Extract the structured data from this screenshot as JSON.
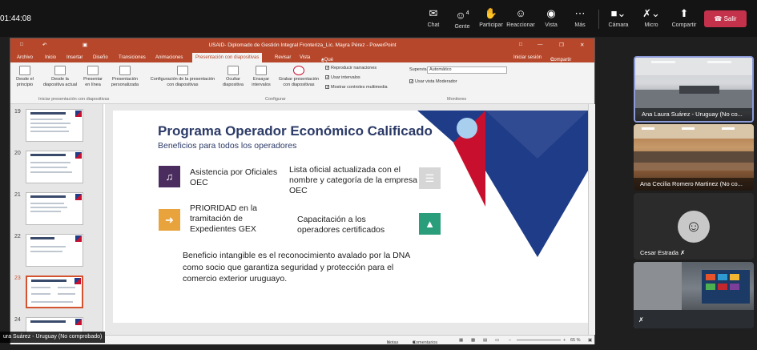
{
  "meeting": {
    "timer": "01:44:08",
    "toolbar": [
      {
        "label": "Chat",
        "icon": "chat-icon",
        "glyph": "✉"
      },
      {
        "label": "Gente",
        "icon": "people-icon",
        "glyph": "☺",
        "count": "4"
      },
      {
        "label": "Participar",
        "icon": "raise-hand-icon",
        "glyph": "✋"
      },
      {
        "label": "Reaccionar",
        "icon": "react-icon",
        "glyph": "☺"
      },
      {
        "label": "Vista",
        "icon": "view-icon",
        "glyph": "◉"
      },
      {
        "label": "Más",
        "icon": "more-icon",
        "glyph": "⋯"
      }
    ],
    "camera_label": "Cámara",
    "mic_label": "Micro",
    "share_label": "Compartir",
    "leave_label": "Salir",
    "leave_color": "#c4314b"
  },
  "powerpoint": {
    "window_title": "USAID- Diplomado de Gestión Integral Fronteriza_Lic. Mayra Pérez - PowerPoint",
    "menu": [
      "Archivo",
      "Inicio",
      "Insertar",
      "Diseño",
      "Transiciones",
      "Animaciones",
      "Presentación con diapositivas",
      "Revisar",
      "Vista"
    ],
    "tell_me": "¿Qué desea hacer?",
    "signin": "Iniciar sesión",
    "share": "Compartir",
    "ribbon": {
      "btn1": "Desde el principio",
      "btn2": "Desde la diapositiva actual",
      "btn3": "Presentar en línea",
      "btn4": "Presentación personalizada",
      "group1": "Iniciar presentación con diapositivas",
      "btn5": "Configuración de la presentación con diapositivas",
      "btn6": "Ocultar diapositiva",
      "btn7": "Ensayar intervalos",
      "btn8": "Grabar presentación con diapositivas",
      "chk1": "Reproducir narraciones",
      "chk2": "Usar intervalos",
      "chk3": "Mostrar controles multimedia",
      "group2": "Configurar",
      "monitor_label": "Supervisar:",
      "monitor_value": "Automático",
      "chk4": "Usar vista Moderador",
      "group3": "Monitores"
    },
    "thumbs": [
      "19",
      "20",
      "21",
      "22",
      "23",
      "24"
    ],
    "slide": {
      "title": "Programa Operador Económico Calificado",
      "subtitle": "Beneficios para todos los operadores",
      "item1": "Asistencia por Oficiales OEC",
      "item2": "Lista oficial actualizada con el nombre y categoría de la empresa OEC",
      "item3": "PRIORIDAD en la tramitación de Expedientes GEX",
      "item4": "Capacitación a los operadores certificados",
      "footer": "Beneficio intangible es el reconocimiento avalado por la DNA como socio que garantiza seguridad y protección para el comercio exterior uruguayo.",
      "colors": {
        "navy": "#1f3c88",
        "red": "#c8102e",
        "title": "#2b3a67"
      }
    },
    "status": {
      "notes": "Notas",
      "comments": "Comentarios",
      "zoom": "65 %"
    }
  },
  "participants": [
    {
      "name": "Ana Laura Suárez - Uruguay (No co...",
      "type": "video"
    },
    {
      "name": "Ana Cecilia Romero Martinez (No co...",
      "type": "video"
    },
    {
      "name": "Cesar Estrada",
      "type": "avatar"
    },
    {
      "name": "",
      "type": "video"
    }
  ],
  "speaker_name": "ura Suárez - Uruguay (No comprobado)"
}
